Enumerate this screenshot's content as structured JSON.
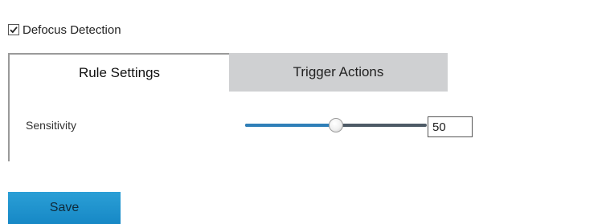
{
  "detection": {
    "label": "Defocus Detection",
    "checked": true
  },
  "tabs": [
    {
      "label": "Rule Settings",
      "active": true
    },
    {
      "label": "Trigger Actions",
      "active": false
    }
  ],
  "sensitivity": {
    "label": "Sensitivity",
    "value": "50",
    "slider_fraction": 0.5
  },
  "save_label": "Save",
  "colors": {
    "accent": "#1688c6",
    "inactive_tab": "#cfd0d2"
  }
}
